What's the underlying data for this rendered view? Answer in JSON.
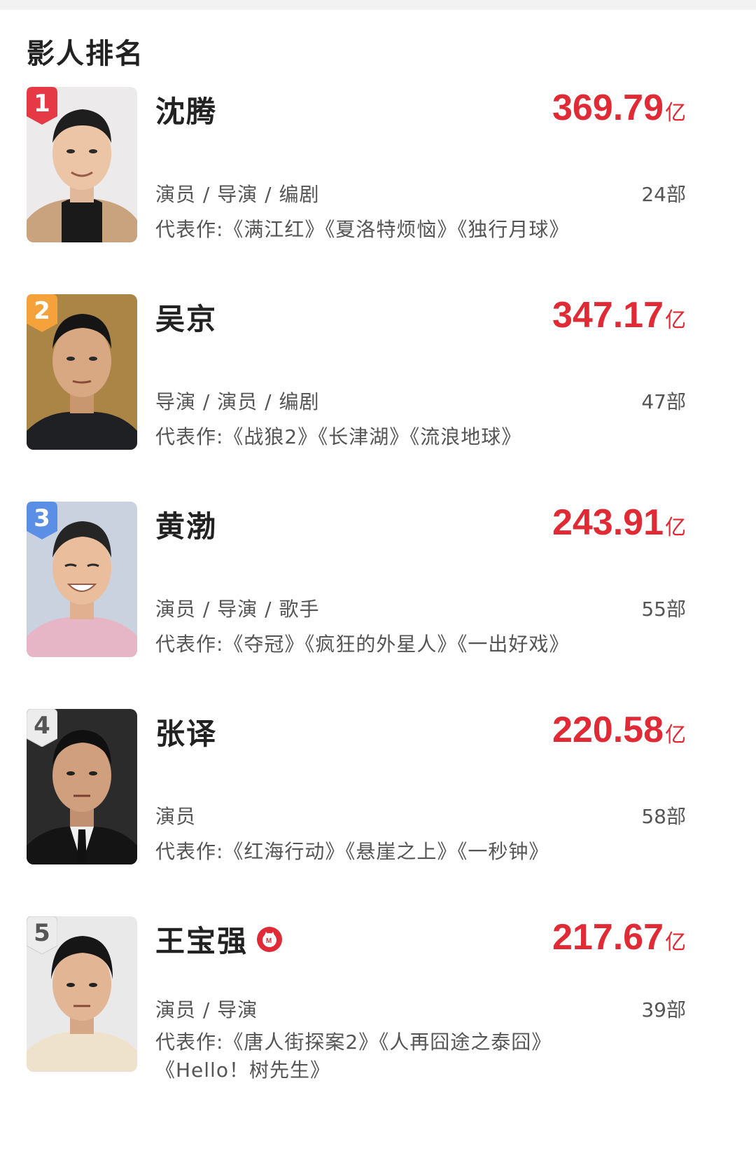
{
  "section_title": "影人排名",
  "colors": {
    "accent": "#e02a35",
    "rank1": "#e53a45",
    "rank2": "#f5a23a",
    "rank3": "#5b8fe6",
    "rank_other": "#dcdcdc"
  },
  "people": [
    {
      "rank": "1",
      "name": "沈腾",
      "gross": "369.79",
      "unit": "亿",
      "roles": "演员 / 导演 / 编剧",
      "count": "24部",
      "works": "代表作:《满江红》《夏洛特烦恼》《独行月球》"
    },
    {
      "rank": "2",
      "name": "吴京",
      "gross": "347.17",
      "unit": "亿",
      "roles": "导演 / 演员 / 编剧",
      "count": "47部",
      "works": "代表作:《战狼2》《长津湖》《流浪地球》"
    },
    {
      "rank": "3",
      "name": "黄渤",
      "gross": "243.91",
      "unit": "亿",
      "roles": "演员 / 导演 / 歌手",
      "count": "55部",
      "works": "代表作:《夺冠》《疯狂的外星人》《一出好戏》"
    },
    {
      "rank": "4",
      "name": "张译",
      "gross": "220.58",
      "unit": "亿",
      "roles": "演员",
      "count": "58部",
      "works": "代表作:《红海行动》《悬崖之上》《一秒钟》"
    },
    {
      "rank": "5",
      "name": "王宝强",
      "gross": "217.67",
      "unit": "亿",
      "roles": "演员 / 导演",
      "count": "39部",
      "works": "代表作:《唐人街探案2》《人再囧途之泰囧》《Hello！树先生》",
      "verified_icon": "maoyan-badge-icon"
    }
  ]
}
